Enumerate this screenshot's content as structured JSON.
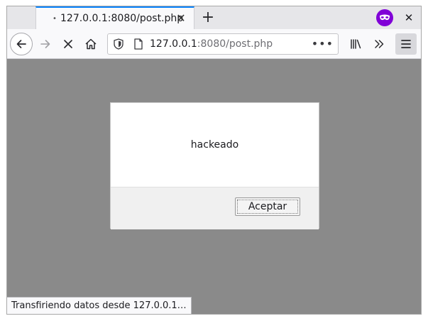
{
  "browser": {
    "tab": {
      "indicator": "•",
      "title": "127.0.0.1:8080/post.php"
    },
    "new_tab_symbol": "+",
    "url": {
      "host": "127.0.0.1",
      "rest": ":8080/post.php"
    },
    "icons": {
      "back": "back-arrow-icon",
      "forward": "forward-arrow-icon",
      "stop": "stop-icon",
      "home": "home-icon",
      "shield": "shield-icon",
      "page": "page-icon",
      "more": "more-dots-icon",
      "library": "library-icon",
      "overflow": "chevrons-icon",
      "menu": "hamburger-icon",
      "private": "private-mask-icon"
    },
    "private_color": "#8000d7"
  },
  "dialog": {
    "message": "hackeado",
    "ok_label": "Aceptar"
  },
  "status_bar": {
    "text": "Transfiriendo datos desde 127.0.0.1…"
  }
}
